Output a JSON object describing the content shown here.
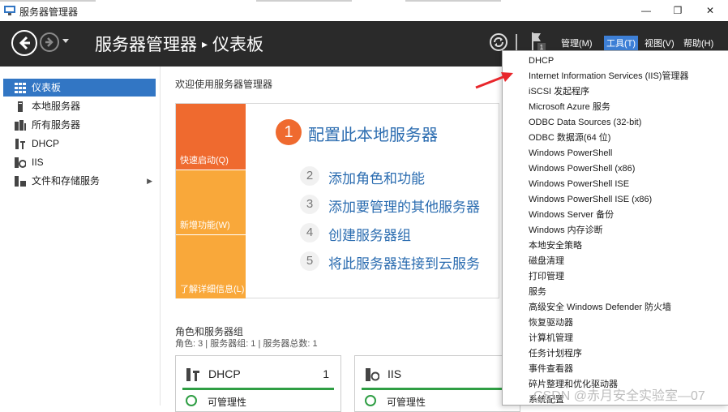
{
  "window": {
    "title": "服务器管理器",
    "minimize": "—",
    "maximize": "❐",
    "close": "✕"
  },
  "header": {
    "breadcrumb_app": "服务器管理器",
    "breadcrumb_sep": "▸",
    "breadcrumb_page": "仪表板",
    "notification_count": "1",
    "menus": [
      "管理(M)",
      "工具(T)",
      "视图(V)",
      "帮助(H)"
    ]
  },
  "sidebar": {
    "items": [
      {
        "label": "仪表板",
        "icon": "dashboard-icon"
      },
      {
        "label": "本地服务器",
        "icon": "server-icon"
      },
      {
        "label": "所有服务器",
        "icon": "servers-icon"
      },
      {
        "label": "DHCP",
        "icon": "dhcp-icon"
      },
      {
        "label": "IIS",
        "icon": "iis-icon"
      },
      {
        "label": "文件和存储服务",
        "icon": "storage-icon"
      }
    ],
    "expand_arrow": "▶"
  },
  "welcome": {
    "title": "欢迎使用服务器管理器",
    "tiles": [
      "快速启动(Q)",
      "新增功能(W)",
      "了解详细信息(L)"
    ],
    "step1_num": "1",
    "step1_text": "配置此本地服务器",
    "steps": [
      {
        "num": "2",
        "text": "添加角色和功能"
      },
      {
        "num": "3",
        "text": "添加要管理的其他服务器"
      },
      {
        "num": "4",
        "text": "创建服务器组"
      },
      {
        "num": "5",
        "text": "将此服务器连接到云服务"
      }
    ]
  },
  "roles": {
    "title": "角色和服务器组",
    "summary": "角色: 3 | 服务器组: 1 | 服务器总数: 1",
    "cards": [
      {
        "name": "DHCP",
        "count": "1",
        "status": "可管理性"
      },
      {
        "name": "IIS",
        "count": "",
        "status": "可管理性"
      }
    ]
  },
  "tools_menu": {
    "items": [
      "DHCP",
      "Internet Information Services (IIS)管理器",
      "iSCSI 发起程序",
      "Microsoft Azure 服务",
      "ODBC Data Sources (32-bit)",
      "ODBC 数据源(64 位)",
      "Windows PowerShell",
      "Windows PowerShell (x86)",
      "Windows PowerShell ISE",
      "Windows PowerShell ISE (x86)",
      "Windows Server 备份",
      "Windows 内存诊断",
      "本地安全策略",
      "磁盘清理",
      "打印管理",
      "服务",
      "高级安全 Windows Defender 防火墙",
      "恢复驱动器",
      "计算机管理",
      "任务计划程序",
      "事件查看器",
      "碎片整理和优化驱动器",
      "系统配置"
    ]
  },
  "watermark": "CSDN @赤月安全实验室—07",
  "colors": {
    "header_bg": "#2a2a2a",
    "sidebar_active": "#3276c4",
    "tile_orange": "#ef6a2f",
    "tile_light": "#f9a83a",
    "link_blue": "#2b6cb0",
    "status_green": "#2f9e44",
    "annotation_red": "#e8262b"
  }
}
